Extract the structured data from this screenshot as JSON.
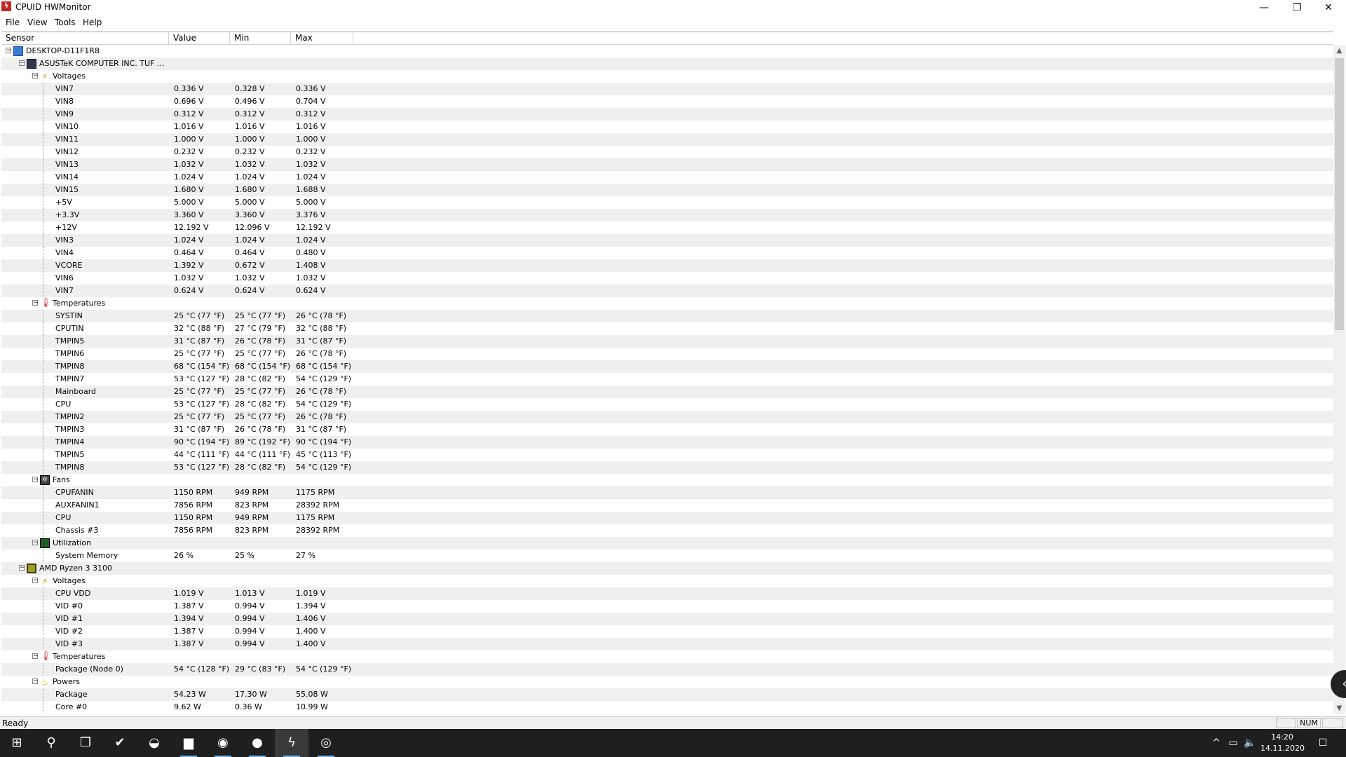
{
  "window": {
    "title": "CPUID HWMonitor",
    "app_icon": "hwmonitor-icon",
    "controls": {
      "minimize": "—",
      "restore": "❐",
      "close": "✕"
    }
  },
  "menu": [
    "File",
    "View",
    "Tools",
    "Help"
  ],
  "columns": [
    "Sensor",
    "Value",
    "Min",
    "Max"
  ],
  "tree": [
    {
      "level": 0,
      "type": "node",
      "icon": "computer",
      "label": "DESKTOP-D11F1R8"
    },
    {
      "level": 1,
      "type": "node",
      "icon": "board",
      "label": "ASUSTeK COMPUTER INC. TUF ..."
    },
    {
      "level": 2,
      "type": "node",
      "icon": "volt",
      "label": "Voltages"
    },
    {
      "level": 3,
      "type": "leaf",
      "label": "VIN7",
      "value": "0.336 V",
      "min": "0.328 V",
      "max": "0.336 V"
    },
    {
      "level": 3,
      "type": "leaf",
      "label": "VIN8",
      "value": "0.696 V",
      "min": "0.496 V",
      "max": "0.704 V"
    },
    {
      "level": 3,
      "type": "leaf",
      "label": "VIN9",
      "value": "0.312 V",
      "min": "0.312 V",
      "max": "0.312 V"
    },
    {
      "level": 3,
      "type": "leaf",
      "label": "VIN10",
      "value": "1.016 V",
      "min": "1.016 V",
      "max": "1.016 V"
    },
    {
      "level": 3,
      "type": "leaf",
      "label": "VIN11",
      "value": "1.000 V",
      "min": "1.000 V",
      "max": "1.000 V"
    },
    {
      "level": 3,
      "type": "leaf",
      "label": "VIN12",
      "value": "0.232 V",
      "min": "0.232 V",
      "max": "0.232 V"
    },
    {
      "level": 3,
      "type": "leaf",
      "label": "VIN13",
      "value": "1.032 V",
      "min": "1.032 V",
      "max": "1.032 V"
    },
    {
      "level": 3,
      "type": "leaf",
      "label": "VIN14",
      "value": "1.024 V",
      "min": "1.024 V",
      "max": "1.024 V"
    },
    {
      "level": 3,
      "type": "leaf",
      "label": "VIN15",
      "value": "1.680 V",
      "min": "1.680 V",
      "max": "1.688 V"
    },
    {
      "level": 3,
      "type": "leaf",
      "label": "+5V",
      "value": "5.000 V",
      "min": "5.000 V",
      "max": "5.000 V"
    },
    {
      "level": 3,
      "type": "leaf",
      "label": "+3.3V",
      "value": "3.360 V",
      "min": "3.360 V",
      "max": "3.376 V"
    },
    {
      "level": 3,
      "type": "leaf",
      "label": "+12V",
      "value": "12.192 V",
      "min": "12.096 V",
      "max": "12.192 V"
    },
    {
      "level": 3,
      "type": "leaf",
      "label": "VIN3",
      "value": "1.024 V",
      "min": "1.024 V",
      "max": "1.024 V"
    },
    {
      "level": 3,
      "type": "leaf",
      "label": "VIN4",
      "value": "0.464 V",
      "min": "0.464 V",
      "max": "0.480 V"
    },
    {
      "level": 3,
      "type": "leaf",
      "label": "VCORE",
      "value": "1.392 V",
      "min": "0.672 V",
      "max": "1.408 V"
    },
    {
      "level": 3,
      "type": "leaf",
      "label": "VIN6",
      "value": "1.032 V",
      "min": "1.032 V",
      "max": "1.032 V"
    },
    {
      "level": 3,
      "type": "leaf",
      "label": "VIN7",
      "value": "0.624 V",
      "min": "0.624 V",
      "max": "0.624 V"
    },
    {
      "level": 2,
      "type": "node",
      "icon": "temp",
      "label": "Temperatures"
    },
    {
      "level": 3,
      "type": "leaf",
      "label": "SYSTIN",
      "value": "25 °C  (77 °F)",
      "min": "25 °C  (77 °F)",
      "max": "26 °C  (78 °F)"
    },
    {
      "level": 3,
      "type": "leaf",
      "label": "CPUTIN",
      "value": "32 °C  (88 °F)",
      "min": "27 °C  (79 °F)",
      "max": "32 °C  (88 °F)"
    },
    {
      "level": 3,
      "type": "leaf",
      "label": "TMPIN5",
      "value": "31 °C  (87 °F)",
      "min": "26 °C  (78 °F)",
      "max": "31 °C  (87 °F)"
    },
    {
      "level": 3,
      "type": "leaf",
      "label": "TMPIN6",
      "value": "25 °C  (77 °F)",
      "min": "25 °C  (77 °F)",
      "max": "26 °C  (78 °F)"
    },
    {
      "level": 3,
      "type": "leaf",
      "label": "TMPIN8",
      "value": "68 °C  (154 °F)",
      "min": "68 °C  (154 °F)",
      "max": "68 °C  (154 °F)"
    },
    {
      "level": 3,
      "type": "leaf",
      "label": "TMPIN7",
      "value": "53 °C  (127 °F)",
      "min": "28 °C  (82 °F)",
      "max": "54 °C  (129 °F)"
    },
    {
      "level": 3,
      "type": "leaf",
      "label": "Mainboard",
      "value": "25 °C  (77 °F)",
      "min": "25 °C  (77 °F)",
      "max": "26 °C  (78 °F)"
    },
    {
      "level": 3,
      "type": "leaf",
      "label": "CPU",
      "value": "53 °C  (127 °F)",
      "min": "28 °C  (82 °F)",
      "max": "54 °C  (129 °F)"
    },
    {
      "level": 3,
      "type": "leaf",
      "label": "TMPIN2",
      "value": "25 °C  (77 °F)",
      "min": "25 °C  (77 °F)",
      "max": "26 °C  (78 °F)"
    },
    {
      "level": 3,
      "type": "leaf",
      "label": "TMPIN3",
      "value": "31 °C  (87 °F)",
      "min": "26 °C  (78 °F)",
      "max": "31 °C  (87 °F)"
    },
    {
      "level": 3,
      "type": "leaf",
      "label": "TMPIN4",
      "value": "90 °C  (194 °F)",
      "min": "89 °C  (192 °F)",
      "max": "90 °C  (194 °F)"
    },
    {
      "level": 3,
      "type": "leaf",
      "label": "TMPIN5",
      "value": "44 °C  (111 °F)",
      "min": "44 °C  (111 °F)",
      "max": "45 °C  (113 °F)"
    },
    {
      "level": 3,
      "type": "leaf",
      "label": "TMPIN8",
      "value": "53 °C  (127 °F)",
      "min": "28 °C  (82 °F)",
      "max": "54 °C  (129 °F)"
    },
    {
      "level": 2,
      "type": "node",
      "icon": "fan",
      "label": "Fans"
    },
    {
      "level": 3,
      "type": "leaf",
      "label": "CPUFANIN",
      "value": "1150 RPM",
      "min": "949 RPM",
      "max": "1175 RPM"
    },
    {
      "level": 3,
      "type": "leaf",
      "label": "AUXFANIN1",
      "value": "7856 RPM",
      "min": "823 RPM",
      "max": "28392 RPM"
    },
    {
      "level": 3,
      "type": "leaf",
      "label": "CPU",
      "value": "1150 RPM",
      "min": "949 RPM",
      "max": "1175 RPM"
    },
    {
      "level": 3,
      "type": "leaf",
      "label": "Chassis #3",
      "value": "7856 RPM",
      "min": "823 RPM",
      "max": "28392 RPM"
    },
    {
      "level": 2,
      "type": "node",
      "icon": "util",
      "label": "Utilization"
    },
    {
      "level": 3,
      "type": "leaf",
      "label": "System Memory",
      "value": "26 %",
      "min": "25 %",
      "max": "27 %"
    },
    {
      "level": 1,
      "type": "node",
      "icon": "cpu",
      "label": "AMD Ryzen 3 3100"
    },
    {
      "level": 2,
      "type": "node",
      "icon": "volt",
      "label": "Voltages"
    },
    {
      "level": 3,
      "type": "leaf",
      "label": "CPU VDD",
      "value": "1.019 V",
      "min": "1.013 V",
      "max": "1.019 V"
    },
    {
      "level": 3,
      "type": "leaf",
      "label": "VID #0",
      "value": "1.387 V",
      "min": "0.994 V",
      "max": "1.394 V"
    },
    {
      "level": 3,
      "type": "leaf",
      "label": "VID #1",
      "value": "1.394 V",
      "min": "0.994 V",
      "max": "1.406 V"
    },
    {
      "level": 3,
      "type": "leaf",
      "label": "VID #2",
      "value": "1.387 V",
      "min": "0.994 V",
      "max": "1.400 V"
    },
    {
      "level": 3,
      "type": "leaf",
      "label": "VID #3",
      "value": "1.387 V",
      "min": "0.994 V",
      "max": "1.400 V"
    },
    {
      "level": 2,
      "type": "node",
      "icon": "temp",
      "label": "Temperatures"
    },
    {
      "level": 3,
      "type": "leaf",
      "label": "Package (Node 0)",
      "value": "54 °C  (128 °F)",
      "min": "29 °C  (83 °F)",
      "max": "54 °C  (129 °F)"
    },
    {
      "level": 2,
      "type": "node",
      "icon": "power",
      "label": "Powers"
    },
    {
      "level": 3,
      "type": "leaf",
      "label": "Package",
      "value": "54.23 W",
      "min": "17.30 W",
      "max": "55.08 W"
    },
    {
      "level": 3,
      "type": "leaf",
      "label": "Core #0",
      "value": "9.62 W",
      "min": "0.36 W",
      "max": "10.99 W"
    }
  ],
  "status": {
    "text": "Ready",
    "num": "NUM"
  },
  "taskbar": {
    "apps": [
      {
        "name": "start-icon",
        "glyph": "⊞"
      },
      {
        "name": "search-icon",
        "glyph": "⚲"
      },
      {
        "name": "task-view-icon",
        "glyph": "❒"
      },
      {
        "name": "checkmark-app-icon",
        "glyph": "✔"
      },
      {
        "name": "steam-icon",
        "glyph": "◒"
      },
      {
        "name": "file-explorer-icon",
        "glyph": "▆"
      },
      {
        "name": "edge-icon",
        "glyph": "◉"
      },
      {
        "name": "media-player-icon",
        "glyph": "●"
      },
      {
        "name": "hwmonitor-taskbar-icon",
        "glyph": "ϟ"
      },
      {
        "name": "browser-icon",
        "glyph": "◎"
      }
    ],
    "tray": {
      "chevron": "^",
      "network": "▭",
      "volume": "🔈"
    },
    "time": "14:20",
    "date": "14.11.2020",
    "notification": "☐"
  }
}
